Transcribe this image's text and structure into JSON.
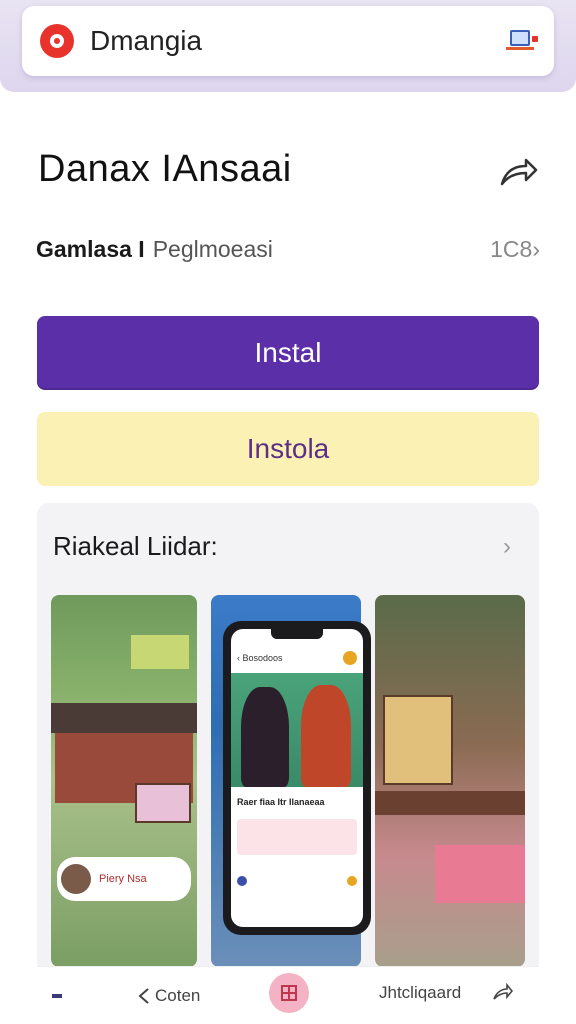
{
  "header": {
    "search_text": "Dmangia"
  },
  "app": {
    "title": "Danax IAnsaai",
    "developer": "Gamlasa I",
    "category": "Peglmoeasi",
    "count": "1C8›"
  },
  "actions": {
    "install_label": "Instal",
    "secondary_label": "Instola"
  },
  "preview": {
    "title": "Riakeal Liidar:",
    "chevron": "›",
    "shot1_caption": "Piery Nsa",
    "phone_header": "Bosodoos",
    "phone_caption": "Raer fiaa Itr Ilanaeaa"
  },
  "bottom_nav": {
    "back_label": "Coten",
    "right_label": "Jhtcliqaard"
  },
  "colors": {
    "primary": "#5b2fa8",
    "secondary_bg": "#fbf1b5",
    "secondary_text": "#5b2f88",
    "header_bg": "#e3ddf1",
    "accent_red": "#e8322c"
  }
}
